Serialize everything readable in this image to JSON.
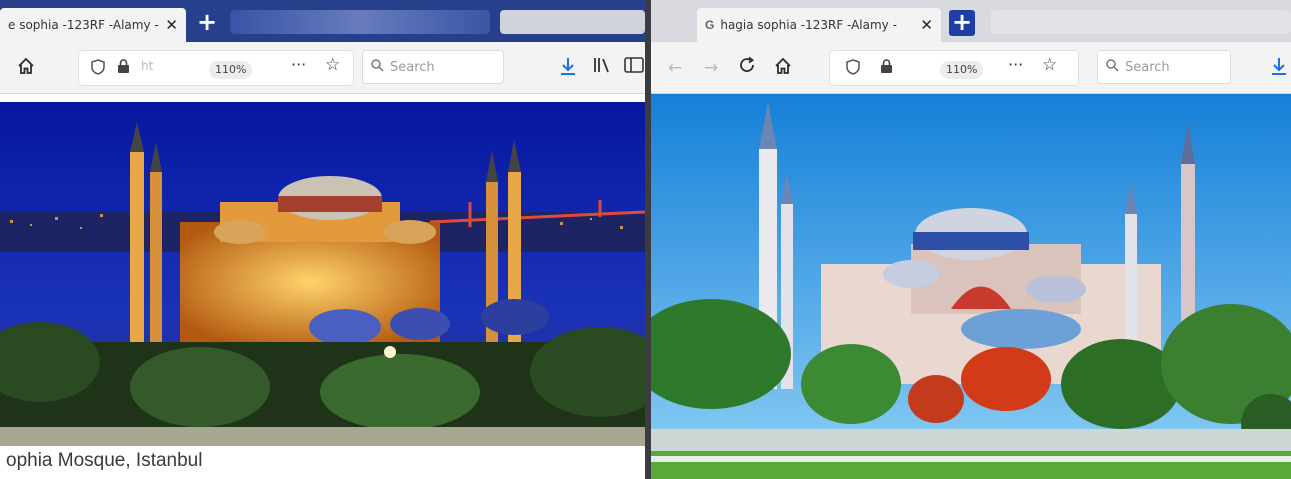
{
  "left_window": {
    "tab": {
      "title": "e sophia -123RF -Alamy -",
      "close": "✕"
    },
    "new_tab": "+",
    "toolbar": {
      "home_icon": "home-icon",
      "shield_icon": "shield-icon",
      "lock_icon": "lock-icon",
      "url_fragment": "ht",
      "zoom": "110%",
      "more": "···",
      "star": "☆",
      "search_placeholder": "Search",
      "download_icon": "download-icon",
      "library_icon": "library-icon",
      "sidebar_icon": "sidebar-icon"
    },
    "caption": "ophia Mosque, Istanbul"
  },
  "right_window": {
    "tab": {
      "favicon": "G",
      "title": "hagia sophia -123RF -Alamy -",
      "close": "✕"
    },
    "new_tab": "+",
    "toolbar": {
      "back": "←",
      "forward": "→",
      "reload": "C",
      "home_icon": "home-icon",
      "shield_icon": "shield-icon",
      "lock_icon": "lock-icon",
      "zoom": "110%",
      "more": "···",
      "star": "☆",
      "search_placeholder": "Search",
      "download_icon": "download-icon"
    }
  },
  "colors": {
    "night_sky": "#0a1fa8",
    "day_sky": "#1b8fe0",
    "tab_strip_left": "#27408b",
    "tab_strip_right": "#d9dadf",
    "download_blue": "#1a73e8"
  }
}
